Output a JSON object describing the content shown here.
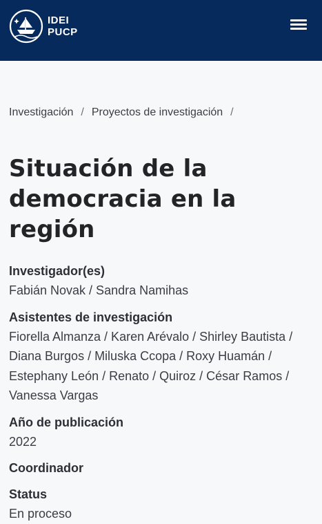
{
  "header": {
    "logo_line1": "IDEI",
    "logo_line2": "PUCP",
    "menu_icon": "hamburger-menu-icon"
  },
  "breadcrumb": [
    {
      "label": "Investigación"
    },
    {
      "label": "Proyectos de investigación"
    }
  ],
  "breadcrumb_separator": "/",
  "page": {
    "title": "Situación de la democracia en la región"
  },
  "details": [
    {
      "label": "Investigador(es)",
      "value": "Fabián Novak / Sandra Namihas"
    },
    {
      "label": "Asistentes de investigación",
      "value": "Fiorella Almanza / Karen Arévalo / Shirley Bautista / Diana Burgos / Miluska Ccopa / Roxy Huamán / Estephany León / Renato / Quiroz / César Ramos / Vanessa Vargas"
    },
    {
      "label": "Año de publicación",
      "value": "2022"
    },
    {
      "label": "Coordinador",
      "value": ""
    },
    {
      "label": "Status",
      "value": "En proceso"
    }
  ],
  "colors": {
    "header_bg": "#062a5c",
    "page_bg": "#f7f8fa",
    "text": "#2c2f35"
  }
}
